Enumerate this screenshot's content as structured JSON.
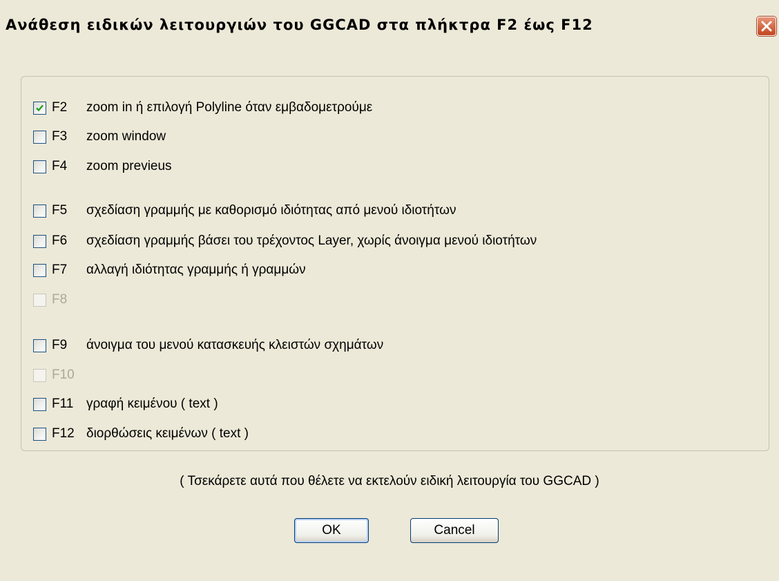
{
  "window": {
    "title": "Ανάθεση ειδικών λειτουργιών του GGCAD στα πλήκτρα F2 έως F12",
    "close_icon": "close-icon"
  },
  "options": [
    {
      "key": "F2",
      "label": "zoom in  ή  επιλογή Polyline όταν εμβαδομετρούμε",
      "checked": true,
      "enabled": true
    },
    {
      "key": "F3",
      "label": "zoom window",
      "checked": false,
      "enabled": true
    },
    {
      "key": "F4",
      "label": "zoom previeus",
      "checked": false,
      "enabled": true
    },
    {
      "key": "F5",
      "label": "σχεδίαση γραμμής με καθορισμό ιδιότητας από μενού ιδιοτήτων",
      "checked": false,
      "enabled": true
    },
    {
      "key": "F6",
      "label": "σχεδίαση γραμμής βάσει του τρέχοντος Layer, χωρίς άνοιγμα μενού ιδιοτήτων",
      "checked": false,
      "enabled": true
    },
    {
      "key": "F7",
      "label": "αλλαγή ιδιότητας γραμμής ή γραμμών",
      "checked": false,
      "enabled": true
    },
    {
      "key": "F8",
      "label": "",
      "checked": false,
      "enabled": false
    },
    {
      "key": "F9",
      "label": "άνοιγμα του μενού κατασκευής κλειστών σχημάτων",
      "checked": false,
      "enabled": true
    },
    {
      "key": "F10",
      "label": "",
      "checked": false,
      "enabled": false
    },
    {
      "key": "F11",
      "label": "γραφή κειμένου ( text )",
      "checked": false,
      "enabled": true
    },
    {
      "key": "F12",
      "label": "διορθώσεις κειμένων ( text )",
      "checked": false,
      "enabled": true
    }
  ],
  "hint": "( Τσεκάρετε αυτά που θέλετε να εκτελούν ειδική λειτουργία του GGCAD )",
  "buttons": {
    "ok_label": "OK",
    "cancel_label": "Cancel"
  }
}
